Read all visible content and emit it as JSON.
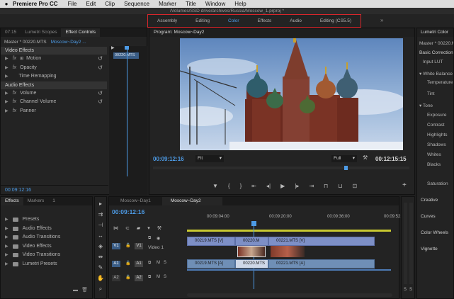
{
  "menubar": {
    "apple": "",
    "app_name": "Premiere Pro CC",
    "items": [
      "File",
      "Edit",
      "Clip",
      "Sequence",
      "Marker",
      "Title",
      "Window",
      "Help"
    ]
  },
  "window": {
    "path": "/Volumes/SSD drive/archives/Russia/Moscow_1.prproj *"
  },
  "workspaces": {
    "tabs": [
      "Assembly",
      "Editing",
      "Color",
      "Effects",
      "Audio",
      "Editing (CS5.5)"
    ],
    "active": "Color",
    "more": "»"
  },
  "source_panel": {
    "tabs": [
      "07:15",
      "Lumetri Scopes",
      "Effect Controls"
    ],
    "master_label": "Master * 00220.MTS",
    "sequence_label": "Moscow~Day2 ...",
    "clip_badge": "00220.MTS",
    "video_effects_header": "Video Effects",
    "video_effects": [
      "Motion",
      "Opacity",
      "Time Remapping"
    ],
    "audio_effects_header": "Audio Effects",
    "audio_effects": [
      "Volume",
      "Channel Volume",
      "Panner"
    ],
    "timecode": "00:09:12:16"
  },
  "program_monitor": {
    "title": "Program: Moscow~Day2",
    "timecode": "00:09:12:16",
    "duration": "00:12:15:15",
    "fit": "Fit",
    "quality": "Full",
    "controls": [
      "mark-in",
      "mark-out",
      "go-in",
      "step-back",
      "play",
      "step-forward",
      "go-out",
      "lift",
      "extract",
      "export-frame"
    ]
  },
  "effects_panel": {
    "tabs": [
      "Effects",
      "Markers",
      "1"
    ],
    "items": [
      "Presets",
      "Audio Effects",
      "Audio Transitions",
      "Video Effects",
      "Video Transitions",
      "Lumetri Presets"
    ]
  },
  "timeline": {
    "tabs": [
      "Moscow~Day1",
      "Moscow~Day2"
    ],
    "timecode": "00:09:12:16",
    "ruler": [
      "00:09:04:00",
      "00:09:20:00",
      "00:09:36:00",
      "00:09:52:00"
    ],
    "tracks": {
      "v1_label": "V1",
      "v1_name": "V1",
      "video_1": "Video 1",
      "a1_label": "A1",
      "a1_name": "A1",
      "m": "M",
      "s": "S",
      "a2_label": "A2",
      "a2_name": "A2"
    },
    "video_clips": [
      "00219.MTS [V]",
      "00220.M",
      "00221.MTS [V]"
    ],
    "audio_clips": [
      "00219.MTS [A]",
      "00220.MTS",
      "00221.MTS [A]"
    ],
    "meter": [
      "S",
      "S"
    ]
  },
  "lumetri_panel": {
    "title": "Lumetri Color",
    "master_label": "Master * 00220.MTS",
    "sections": {
      "basic": "Basic Correction",
      "input_lut": "Input LUT",
      "white_balance": "White Balance",
      "wb_items": [
        "Temperature",
        "Tint"
      ],
      "tone": "Tone",
      "tone_items": [
        "Exposure",
        "Contrast",
        "Highlights",
        "Shadows",
        "Whites",
        "Blacks"
      ],
      "saturation": "Saturation",
      "creative": "Creative",
      "curves": "Curves",
      "color_wheels": "Color Wheels",
      "vignette": "Vignette"
    }
  }
}
